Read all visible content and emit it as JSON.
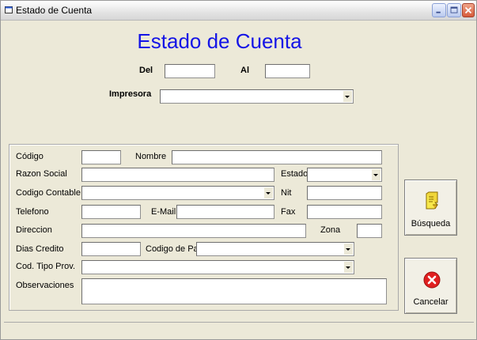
{
  "window": {
    "title": "Estado de Cuenta"
  },
  "header": {
    "title": "Estado de Cuenta",
    "del_label": "Del",
    "del_value": "",
    "al_label": "Al",
    "al_value": "",
    "impresora_label": "Impresora",
    "impresora_value": ""
  },
  "form": {
    "codigo_label": "Código",
    "nombre_label": "Nombre",
    "razon_social_label": "Razon Social",
    "estado_label": "Estado",
    "codigo_contable_label": "Codigo Contable",
    "nit_label": "Nit",
    "telefono_label": "Telefono",
    "email_label": "E-Mail",
    "fax_label": "Fax",
    "direccion_label": "Direccion",
    "zona_label": "Zona",
    "dias_credito_label": "Dias Credito",
    "codigo_pais_label": "Codigo de Pais",
    "cod_tipo_prov_label": "Cod. Tipo Prov.",
    "observaciones_label": "Observaciones"
  },
  "buttons": {
    "busqueda_label": "Búsqueda",
    "busqueda_icon": "notepad-search-icon",
    "cancelar_label": "Cancelar",
    "cancelar_icon": "cancel-x-icon"
  },
  "colors": {
    "title_blue": "#1414E6",
    "cancel_red": "#E02020",
    "window_bg": "#ECE9D8"
  }
}
